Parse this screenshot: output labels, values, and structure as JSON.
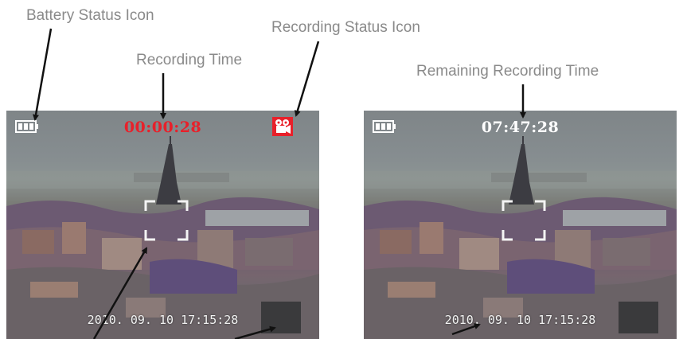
{
  "callouts": {
    "battery": "Battery Status Icon",
    "recording_status": "Recording Status Icon",
    "recording_time": "Recording Time",
    "remaining_time": "Remaining Recording Time"
  },
  "screens": [
    {
      "time": "00:00:28",
      "time_color": "#e8202a",
      "datestamp": "2010. 09. 10 17:15:28",
      "recording_icon": "video-camera-icon"
    },
    {
      "time": "07:47:28",
      "time_color": "#ffffff",
      "datestamp": "2010. 09. 10 17:15:28"
    }
  ],
  "icons": {
    "battery": "battery-icon",
    "focus": "focus-frame-icon"
  },
  "colors": {
    "callout_text": "#8a8a8a",
    "arrow": "#111111",
    "record_red": "#e8202a"
  }
}
